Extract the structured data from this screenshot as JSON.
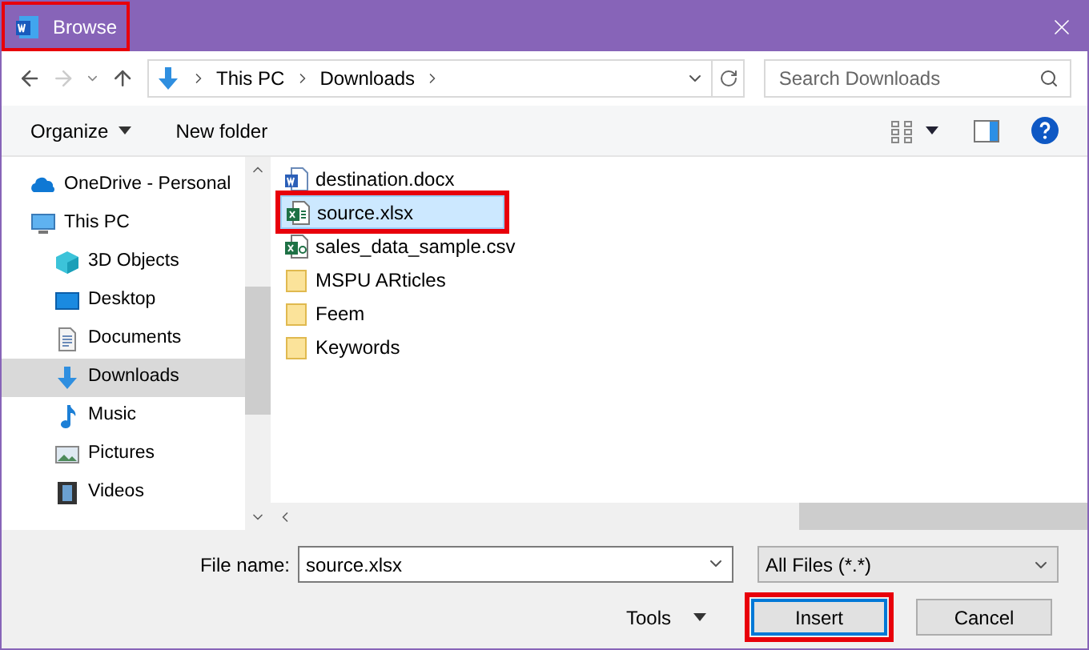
{
  "window": {
    "title": "Browse",
    "title_highlighted": true
  },
  "address": {
    "path": [
      "This PC",
      "Downloads"
    ]
  },
  "search": {
    "placeholder": "Search Downloads"
  },
  "toolbar": {
    "organize": "Organize",
    "new_folder": "New folder"
  },
  "sidebar": {
    "items": [
      {
        "label": "OneDrive - Personal",
        "kind": "cloud",
        "selected": false
      },
      {
        "label": "This PC",
        "kind": "computer",
        "selected": false,
        "children": [
          {
            "label": "3D Objects",
            "kind": "cube",
            "selected": false
          },
          {
            "label": "Desktop",
            "kind": "desktop",
            "selected": false
          },
          {
            "label": "Documents",
            "kind": "document",
            "selected": false
          },
          {
            "label": "Downloads",
            "kind": "download",
            "selected": true
          },
          {
            "label": "Music",
            "kind": "music",
            "selected": false
          },
          {
            "label": "Pictures",
            "kind": "pictures",
            "selected": false
          },
          {
            "label": "Videos",
            "kind": "videos",
            "selected": false
          }
        ]
      }
    ]
  },
  "files": [
    {
      "name": "destination.docx",
      "kind": "word",
      "selected": false,
      "highlighted": false
    },
    {
      "name": "source.xlsx",
      "kind": "excel",
      "selected": true,
      "highlighted": true
    },
    {
      "name": "sales_data_sample.csv",
      "kind": "csv",
      "selected": false,
      "highlighted": false
    },
    {
      "name": "MSPU ARticles",
      "kind": "folder",
      "selected": false,
      "highlighted": false
    },
    {
      "name": "Feem",
      "kind": "folder",
      "selected": false,
      "highlighted": false
    },
    {
      "name": "Keywords",
      "kind": "folder",
      "selected": false,
      "highlighted": false
    }
  ],
  "file_name": {
    "label": "File name:",
    "value": "source.xlsx"
  },
  "file_type": {
    "value": "All Files (*.*)"
  },
  "tools": "Tools",
  "buttons": [
    {
      "label": "Insert",
      "default": true,
      "highlighted": true
    },
    {
      "label": "Cancel",
      "default": false,
      "highlighted": false
    }
  ]
}
